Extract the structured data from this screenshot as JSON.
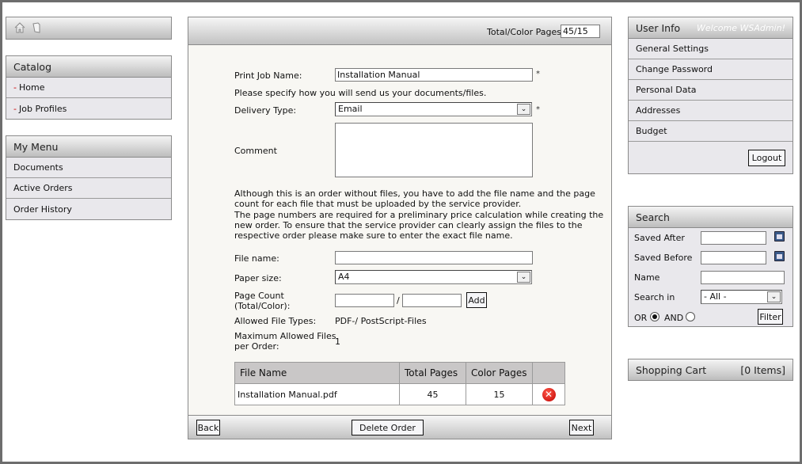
{
  "toolbar": {
    "icons": [
      "home-icon",
      "document-icon"
    ]
  },
  "catalog": {
    "title": "Catalog",
    "items": [
      {
        "prefix": "-",
        "label": "Home"
      },
      {
        "prefix": "-",
        "label": "Job Profiles"
      }
    ]
  },
  "my_menu": {
    "title": "My Menu",
    "items": [
      "Documents",
      "Active Orders",
      "Order History"
    ]
  },
  "main": {
    "total_color_label": "Total/Color Pages:",
    "total_color_value": "45/15",
    "print_job_label": "Print Job Name:",
    "print_job_value": "Installation Manual",
    "required": "*",
    "specify_text": "Please specify how you will send us your documents/files.",
    "delivery_label": "Delivery Type:",
    "delivery_value": "Email",
    "comment_label": "Comment",
    "comment_value": "",
    "info_lines": [
      "Although this is an order without files, you have to add the file name and the page",
      "count for each file that must be uploaded by the service provider.",
      "The page numbers are required for a preliminary price calculation while creating the",
      "new order. To ensure that the service provider can clearly assign the files to the",
      "respective order please make sure to enter the exact file name."
    ],
    "file_name_label": "File name:",
    "file_name_value": "",
    "paper_size_label": "Paper size:",
    "paper_size_value": "A4",
    "page_count_label_1": "Page Count",
    "page_count_label_2": "(Total/Color):",
    "page_count_sep": "/",
    "add_label": "Add",
    "allowed_types_label": "Allowed File Types:",
    "allowed_types_value": "PDF-/ PostScript-Files",
    "max_files_label_1": "Maximum Allowed Files",
    "max_files_label_2": "per Order:",
    "max_files_value": "1",
    "table": {
      "headers": [
        "File Name",
        "Total Pages",
        "Color Pages",
        ""
      ],
      "rows": [
        {
          "file": "Installation Manual.pdf",
          "total": "45",
          "color": "15"
        }
      ]
    },
    "back_label": "Back",
    "delete_label": "Delete Order",
    "next_label": "Next"
  },
  "user_info": {
    "title": "User Info",
    "welcome": "Welcome WSAdmin!",
    "items": [
      "General Settings",
      "Change Password",
      "Personal Data",
      "Addresses",
      "Budget"
    ],
    "logout": "Logout"
  },
  "search": {
    "title": "Search",
    "saved_after": "Saved After",
    "saved_before": "Saved Before",
    "name": "Name",
    "search_in": "Search in",
    "search_in_value": "- All -",
    "or": "OR",
    "and": "AND",
    "selected": "OR",
    "filter": "Filter"
  },
  "cart": {
    "title": "Shopping Cart",
    "count": "[0 Items]"
  }
}
